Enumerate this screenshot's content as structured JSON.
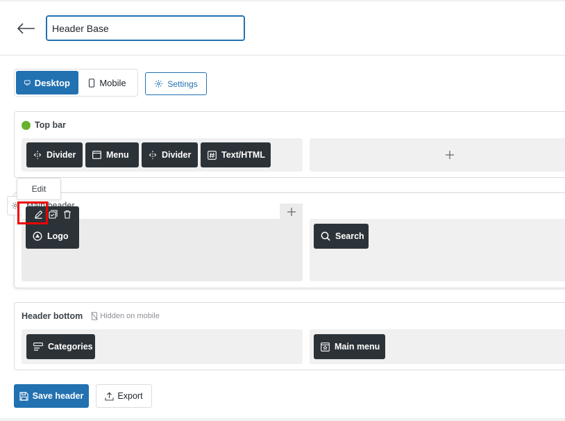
{
  "header_title_value": "Header Base",
  "device_toggle": {
    "desktop": "Desktop",
    "mobile": "Mobile",
    "selected": "Desktop"
  },
  "settings_label": "Settings",
  "sections": {
    "top_bar": {
      "title": "Top bar",
      "status_color": "#67b32e",
      "items": [
        "Divider",
        "Menu",
        "Divider",
        "Text/HTML"
      ]
    },
    "main_header": {
      "title": "Main header",
      "left_items": [
        "Logo"
      ],
      "right_items": [
        "Search"
      ]
    },
    "header_bottom": {
      "title": "Header bottom",
      "note": "Hidden on mobile",
      "left_items": [
        "Categories"
      ],
      "right_items": [
        "Main menu"
      ]
    }
  },
  "edit_tooltip": "Edit",
  "buttons": {
    "save": "Save header",
    "export": "Export"
  },
  "colors": {
    "primary": "#2271b1",
    "chip": "#2c3338",
    "highlight": "#e00000"
  }
}
